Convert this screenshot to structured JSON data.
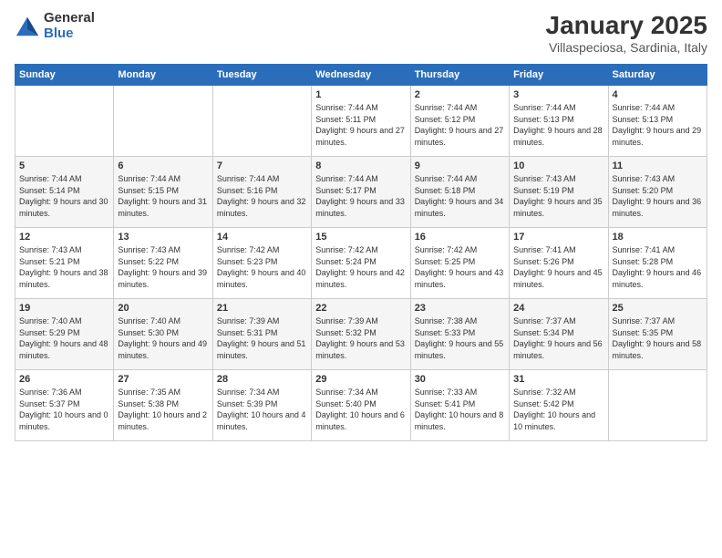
{
  "logo": {
    "general": "General",
    "blue": "Blue"
  },
  "title": "January 2025",
  "subtitle": "Villaspeciosa, Sardinia, Italy",
  "days_of_week": [
    "Sunday",
    "Monday",
    "Tuesday",
    "Wednesday",
    "Thursday",
    "Friday",
    "Saturday"
  ],
  "weeks": [
    [
      {
        "day": "",
        "info": ""
      },
      {
        "day": "",
        "info": ""
      },
      {
        "day": "",
        "info": ""
      },
      {
        "day": "1",
        "info": "Sunrise: 7:44 AM\nSunset: 5:11 PM\nDaylight: 9 hours and 27 minutes."
      },
      {
        "day": "2",
        "info": "Sunrise: 7:44 AM\nSunset: 5:12 PM\nDaylight: 9 hours and 27 minutes."
      },
      {
        "day": "3",
        "info": "Sunrise: 7:44 AM\nSunset: 5:13 PM\nDaylight: 9 hours and 28 minutes."
      },
      {
        "day": "4",
        "info": "Sunrise: 7:44 AM\nSunset: 5:13 PM\nDaylight: 9 hours and 29 minutes."
      }
    ],
    [
      {
        "day": "5",
        "info": "Sunrise: 7:44 AM\nSunset: 5:14 PM\nDaylight: 9 hours and 30 minutes."
      },
      {
        "day": "6",
        "info": "Sunrise: 7:44 AM\nSunset: 5:15 PM\nDaylight: 9 hours and 31 minutes."
      },
      {
        "day": "7",
        "info": "Sunrise: 7:44 AM\nSunset: 5:16 PM\nDaylight: 9 hours and 32 minutes."
      },
      {
        "day": "8",
        "info": "Sunrise: 7:44 AM\nSunset: 5:17 PM\nDaylight: 9 hours and 33 minutes."
      },
      {
        "day": "9",
        "info": "Sunrise: 7:44 AM\nSunset: 5:18 PM\nDaylight: 9 hours and 34 minutes."
      },
      {
        "day": "10",
        "info": "Sunrise: 7:43 AM\nSunset: 5:19 PM\nDaylight: 9 hours and 35 minutes."
      },
      {
        "day": "11",
        "info": "Sunrise: 7:43 AM\nSunset: 5:20 PM\nDaylight: 9 hours and 36 minutes."
      }
    ],
    [
      {
        "day": "12",
        "info": "Sunrise: 7:43 AM\nSunset: 5:21 PM\nDaylight: 9 hours and 38 minutes."
      },
      {
        "day": "13",
        "info": "Sunrise: 7:43 AM\nSunset: 5:22 PM\nDaylight: 9 hours and 39 minutes."
      },
      {
        "day": "14",
        "info": "Sunrise: 7:42 AM\nSunset: 5:23 PM\nDaylight: 9 hours and 40 minutes."
      },
      {
        "day": "15",
        "info": "Sunrise: 7:42 AM\nSunset: 5:24 PM\nDaylight: 9 hours and 42 minutes."
      },
      {
        "day": "16",
        "info": "Sunrise: 7:42 AM\nSunset: 5:25 PM\nDaylight: 9 hours and 43 minutes."
      },
      {
        "day": "17",
        "info": "Sunrise: 7:41 AM\nSunset: 5:26 PM\nDaylight: 9 hours and 45 minutes."
      },
      {
        "day": "18",
        "info": "Sunrise: 7:41 AM\nSunset: 5:28 PM\nDaylight: 9 hours and 46 minutes."
      }
    ],
    [
      {
        "day": "19",
        "info": "Sunrise: 7:40 AM\nSunset: 5:29 PM\nDaylight: 9 hours and 48 minutes."
      },
      {
        "day": "20",
        "info": "Sunrise: 7:40 AM\nSunset: 5:30 PM\nDaylight: 9 hours and 49 minutes."
      },
      {
        "day": "21",
        "info": "Sunrise: 7:39 AM\nSunset: 5:31 PM\nDaylight: 9 hours and 51 minutes."
      },
      {
        "day": "22",
        "info": "Sunrise: 7:39 AM\nSunset: 5:32 PM\nDaylight: 9 hours and 53 minutes."
      },
      {
        "day": "23",
        "info": "Sunrise: 7:38 AM\nSunset: 5:33 PM\nDaylight: 9 hours and 55 minutes."
      },
      {
        "day": "24",
        "info": "Sunrise: 7:37 AM\nSunset: 5:34 PM\nDaylight: 9 hours and 56 minutes."
      },
      {
        "day": "25",
        "info": "Sunrise: 7:37 AM\nSunset: 5:35 PM\nDaylight: 9 hours and 58 minutes."
      }
    ],
    [
      {
        "day": "26",
        "info": "Sunrise: 7:36 AM\nSunset: 5:37 PM\nDaylight: 10 hours and 0 minutes."
      },
      {
        "day": "27",
        "info": "Sunrise: 7:35 AM\nSunset: 5:38 PM\nDaylight: 10 hours and 2 minutes."
      },
      {
        "day": "28",
        "info": "Sunrise: 7:34 AM\nSunset: 5:39 PM\nDaylight: 10 hours and 4 minutes."
      },
      {
        "day": "29",
        "info": "Sunrise: 7:34 AM\nSunset: 5:40 PM\nDaylight: 10 hours and 6 minutes."
      },
      {
        "day": "30",
        "info": "Sunrise: 7:33 AM\nSunset: 5:41 PM\nDaylight: 10 hours and 8 minutes."
      },
      {
        "day": "31",
        "info": "Sunrise: 7:32 AM\nSunset: 5:42 PM\nDaylight: 10 hours and 10 minutes."
      },
      {
        "day": "",
        "info": ""
      }
    ]
  ]
}
